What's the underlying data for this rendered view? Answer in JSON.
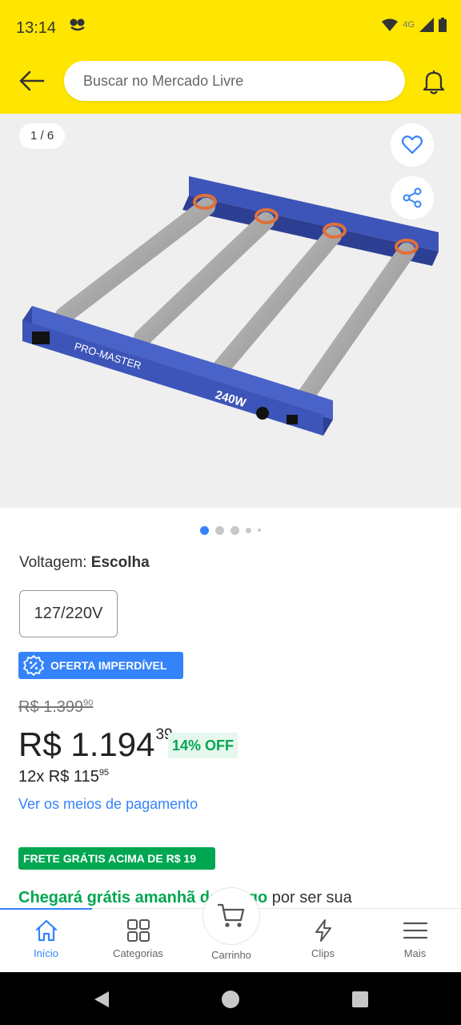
{
  "status_bar": {
    "time": "13:14",
    "network": "4G"
  },
  "header": {
    "search_placeholder": "Buscar no Mercado Livre"
  },
  "gallery": {
    "counter": "1 / 6",
    "image_text_brand": "PRO-MASTER",
    "image_text_power": "240W"
  },
  "variant": {
    "label": "Voltagem: ",
    "selected": "Escolha",
    "option": "127/220V"
  },
  "deal_badge": "OFERTA IMPERDÍVEL",
  "price": {
    "original_main": "R$ 1.399",
    "original_cents": "90",
    "current_main": "R$ 1.194",
    "current_cents": "39",
    "discount": "14% OFF",
    "installments_main": "12x R$ 115",
    "installments_cents": "95",
    "payment_link": "Ver os meios de pagamento"
  },
  "shipping": {
    "badge": "FRETE GRÁTIS ACIMA DE R$ 19",
    "delivery_green": "Chegará grátis amanhã domingo",
    "delivery_rest": " por ser sua"
  },
  "tabbar": {
    "tabs": [
      {
        "label": "Início",
        "icon": "home-icon",
        "active": true
      },
      {
        "label": "Categorias",
        "icon": "grid-icon",
        "active": false
      },
      {
        "label": "Carrinho",
        "icon": "cart-icon",
        "active": false
      },
      {
        "label": "Clips",
        "icon": "clips-icon",
        "active": false
      },
      {
        "label": "Mais",
        "icon": "menu-icon",
        "active": false
      }
    ]
  },
  "colors": {
    "brand_yellow": "#ffe600",
    "accent_blue": "#3483fa",
    "success_green": "#00a650",
    "product_blue": "#3d55b8"
  }
}
